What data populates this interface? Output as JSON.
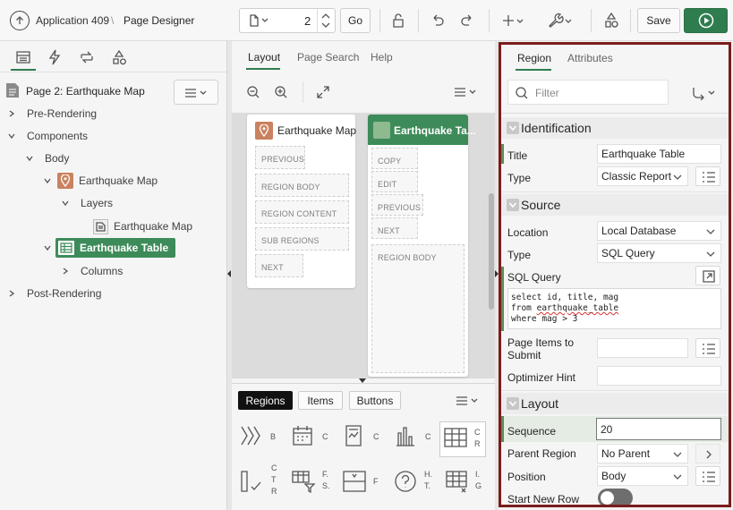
{
  "topbar": {
    "app_link": "Application 409",
    "separator": "\\",
    "page_designer": "Page Designer",
    "page_number": "2",
    "go_label": "Go",
    "save_label": "Save"
  },
  "left": {
    "page_title": "Page 2: Earthquake Map",
    "tree": {
      "pre_rendering": "Pre-Rendering",
      "components": "Components",
      "body": "Body",
      "earthquake_map": "Earthquake Map",
      "layers": "Layers",
      "layer_item": "Earthquake Map",
      "earthquake_table": "Earthquake Table",
      "columns": "Columns",
      "post_rendering": "Post-Rendering"
    }
  },
  "middle": {
    "tabs": [
      "Layout",
      "Page Search",
      "Help"
    ],
    "map_card": {
      "title": "Earthquake Map",
      "slots": [
        "PREVIOUS",
        "REGION BODY",
        "REGION CONTENT",
        "SUB REGIONS",
        "NEXT"
      ]
    },
    "table_card": {
      "title": "Earthquake Ta...",
      "slots": [
        "COPY",
        "EDIT",
        "PREVIOUS",
        "NEXT",
        "REGION BODY"
      ]
    },
    "gallery_tabs": [
      "Regions",
      "Items",
      "Buttons"
    ],
    "gallery_labels": [
      "B",
      "C",
      "C",
      "C",
      "C R",
      "C T R",
      "F. S.",
      "F",
      "H. T.",
      "I. G"
    ]
  },
  "right": {
    "tabs": [
      "Region",
      "Attributes"
    ],
    "filter_placeholder": "Filter",
    "identification": {
      "heading": "Identification",
      "title_label": "Title",
      "title_value": "Earthquake Table",
      "type_label": "Type",
      "type_value": "Classic Report"
    },
    "source": {
      "heading": "Source",
      "location_label": "Location",
      "location_value": "Local Database",
      "type_label": "Type",
      "type_value": "SQL Query",
      "sql_label": "SQL Query",
      "sql_line1": "select id, title, mag",
      "sql_line2_a": "from ",
      "sql_line2_b": "earthquake_table",
      "sql_line3": "where mag > 3",
      "page_items_label_1": "Page Items to",
      "page_items_label_2": "Submit",
      "optimizer_label": "Optimizer Hint"
    },
    "layout": {
      "heading": "Layout",
      "sequence_label": "Sequence",
      "sequence_value": "20",
      "parent_label": "Parent Region",
      "parent_value": "No Parent",
      "position_label": "Position",
      "position_value": "Body",
      "new_row_label": "Start New Row"
    }
  },
  "colors": {
    "accent_green": "#2f7d4f",
    "selection_green": "#3e8b5a",
    "map_pin": "#c9825f",
    "focus_border": "#7b1c1c"
  }
}
